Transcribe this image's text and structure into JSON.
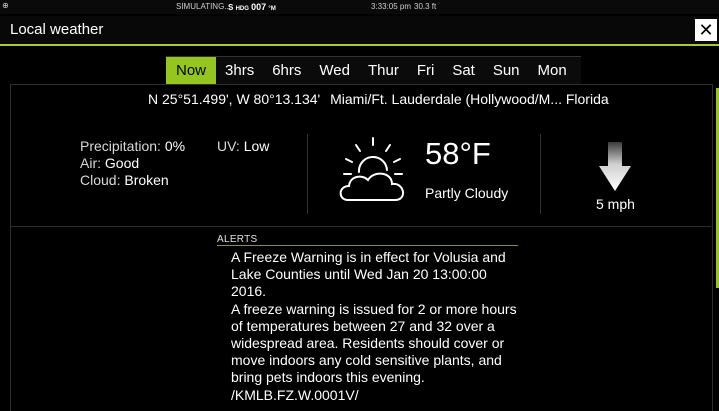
{
  "status_bar": {
    "left": "SIMULATING...",
    "heading_prefix": "S",
    "heading_label": "HDG",
    "heading_value": "007",
    "heading_unit": "°M",
    "time": "3:33:05 pm",
    "depth": "30.3 ft"
  },
  "window": {
    "title": "Local weather",
    "close_label": "✕"
  },
  "tabs": [
    "Now",
    "3hrs",
    "6hrs",
    "Wed",
    "Thur",
    "Fri",
    "Sat",
    "Sun",
    "Mon"
  ],
  "active_tab": "Now",
  "location": {
    "coords": "N 25°51.499', W 80°13.134'",
    "place": "Miami/Ft. Lauderdale (Hollywood/M... Florida"
  },
  "conditions": {
    "precipitation_label": "Precipitation:",
    "precipitation_value": "0%",
    "air_label": "Air:",
    "air_value": "Good",
    "cloud_label": "Cloud:",
    "cloud_value": "Broken",
    "uv_label": "UV:",
    "uv_value": "Low"
  },
  "weather": {
    "icon": "partly-cloudy-icon",
    "temperature": "58°F",
    "condition": "Partly Cloudy"
  },
  "wind": {
    "icon": "wind-direction-arrow-icon",
    "speed": "5 mph"
  },
  "alerts": {
    "label": "ALERTS",
    "text": "A Freeze Warning is in effect for Volusia and Lake Counties until Wed Jan 20 13:00:00 2016.\nA freeze warning is issued for 2 or more hours of temperatures between 27 and 32 over a widespread area. Residents should cover or move indoors any cold sensitive plants, and bring pets indoors this evening.\n/KMLB.FZ.W.0001V/"
  },
  "colors": {
    "accent": "#95c51f",
    "background": "#000000"
  }
}
